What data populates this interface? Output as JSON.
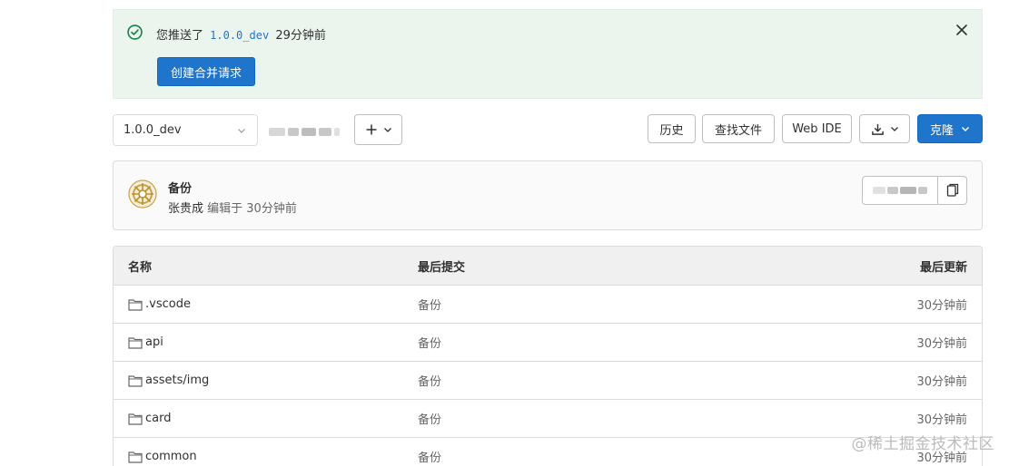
{
  "alert": {
    "prefix": "您推送了",
    "branch": "1.0.0_dev",
    "suffix": "29分钟前",
    "create_mr_label": "创建合并请求"
  },
  "toolbar": {
    "branch_select_value": "1.0.0_dev",
    "history_label": "历史",
    "find_file_label": "查找文件",
    "web_ide_label": "Web IDE",
    "clone_label": "克隆"
  },
  "commit": {
    "title": "备份",
    "author": "张贵成",
    "meta_suffix": "编辑于 30分钟前"
  },
  "file_table": {
    "headers": {
      "name": "名称",
      "last_commit": "最后提交",
      "last_update": "最后更新"
    },
    "rows": [
      {
        "name": ".vscode",
        "commit": "备份",
        "updated": "30分钟前"
      },
      {
        "name": "api",
        "commit": "备份",
        "updated": "30分钟前"
      },
      {
        "name": "assets/img",
        "commit": "备份",
        "updated": "30分钟前"
      },
      {
        "name": "card",
        "commit": "备份",
        "updated": "30分钟前"
      },
      {
        "name": "common",
        "commit": "备份",
        "updated": "30分钟前"
      }
    ]
  },
  "watermark": "@稀土掘金技术社区",
  "colors": {
    "primary": "#1f75cb",
    "alert_bg": "#ecf4ee",
    "success": "#108548"
  }
}
